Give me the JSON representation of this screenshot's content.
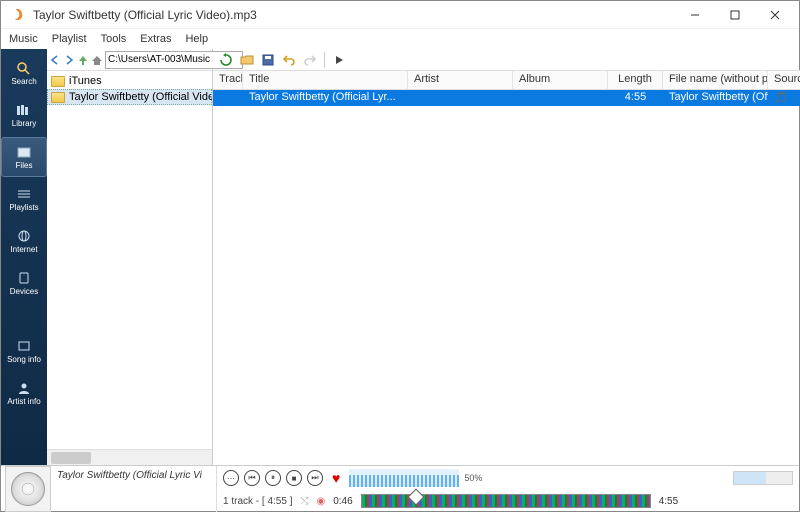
{
  "window": {
    "title": "Taylor Swiftbetty (Official Lyric Video).mp3"
  },
  "menu": [
    "Music",
    "Playlist",
    "Tools",
    "Extras",
    "Help"
  ],
  "sidebar": [
    {
      "label": "Search",
      "icon": "search"
    },
    {
      "label": "Library",
      "icon": "library"
    },
    {
      "label": "Files",
      "icon": "files",
      "active": true
    },
    {
      "label": "Playlists",
      "icon": "playlists"
    },
    {
      "label": "Internet",
      "icon": "internet"
    },
    {
      "label": "Devices",
      "icon": "devices"
    },
    {
      "label": "",
      "spacer": true
    },
    {
      "label": "Song info",
      "icon": "songinfo"
    },
    {
      "label": "Artist info",
      "icon": "artistinfo"
    }
  ],
  "nav": {
    "path": "C:\\Users\\AT-003\\Music"
  },
  "tree": [
    {
      "name": "iTunes"
    },
    {
      "name": "Taylor Swiftbetty (Official Video).",
      "selected": true
    }
  ],
  "columns": [
    "Track",
    "Title",
    "Artist",
    "Album",
    "Length",
    "File name (without path)",
    "Source"
  ],
  "rows": [
    {
      "track": "",
      "title": "Taylor Swiftbetty (Official Lyr...",
      "artist": "",
      "album": "",
      "length": "4:55",
      "file": "Taylor Swiftbetty (Official Lyric ...",
      "source": "🎵"
    }
  ],
  "now_playing": "Taylor Swiftbetty (Official Lyric Vi",
  "volume_pct": "50%",
  "status": {
    "track_count": "1 track - [ 4:55 ]",
    "pos": "0:46",
    "dur": "4:55"
  }
}
